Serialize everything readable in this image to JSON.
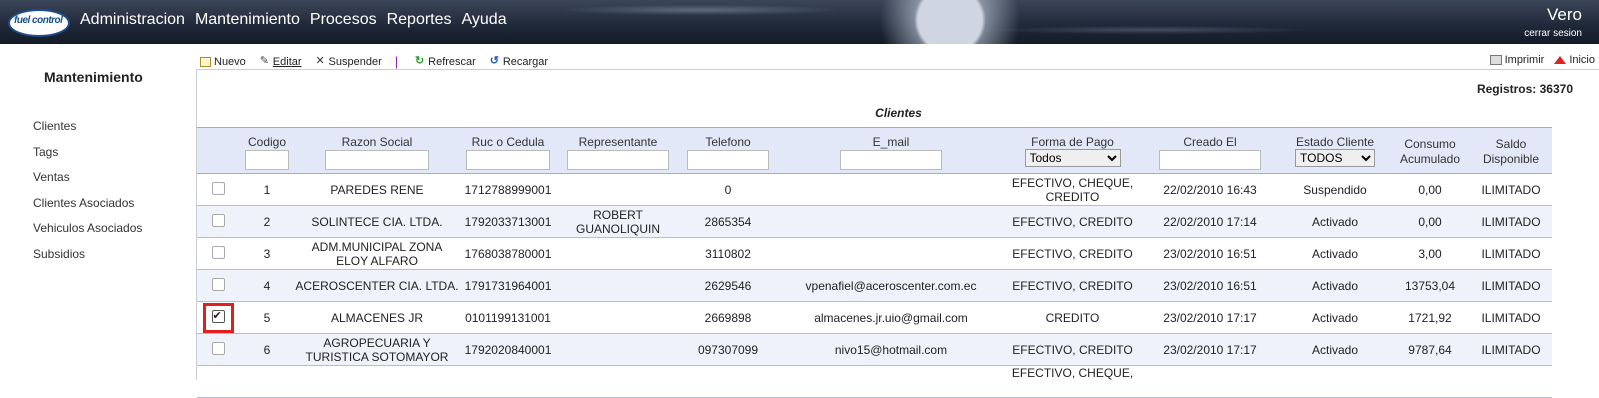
{
  "app": {
    "logo_text": "fuel control",
    "user": "Vero",
    "logout": "cerrar sesion"
  },
  "menu": [
    "Administracion",
    "Mantenimiento",
    "Procesos",
    "Reportes",
    "Ayuda"
  ],
  "sidebar": {
    "title": "Mantenimiento",
    "items": [
      "Clientes",
      "Tags",
      "Ventas",
      "Clientes Asociados",
      "Vehiculos Asociados",
      "Subsidios"
    ]
  },
  "toolbar": {
    "nuevo": "Nuevo",
    "editar": "Editar",
    "suspender": "Suspender",
    "separator": "|",
    "refrescar": "Refrescar",
    "recargar": "Recargar"
  },
  "top_right": {
    "imprimir": "Imprimir",
    "inicio": "Inicio"
  },
  "registros": "Registros: 36370",
  "table_title": "Clientes",
  "columns": [
    "Codigo",
    "Razon Social",
    "Ruc o Cedula",
    "Representante",
    "Telefono",
    "E_mail",
    "Forma de Pago",
    "Creado El",
    "Estado Cliente",
    "Consumo Acumulado",
    "Saldo Disponible"
  ],
  "filters": {
    "forma_pago": "Todos",
    "estado": "TODOS"
  },
  "rows": [
    {
      "checked": false,
      "codigo": "1",
      "razon": "PAREDES RENE",
      "ruc": "1712788999001",
      "rep": "",
      "tel": "0",
      "email": "",
      "pago": "EFECTIVO, CHEQUE, CREDITO",
      "creado": "22/02/2010 16:43",
      "estado": "Suspendido",
      "consumo": "0,00",
      "saldo": "ILIMITADO"
    },
    {
      "checked": false,
      "codigo": "2",
      "razon": "SOLINTECE CIA. LTDA.",
      "ruc": "1792033713001",
      "rep": "ROBERT GUANOLIQUIN",
      "tel": "2865354",
      "email": "",
      "pago": "EFECTIVO, CREDITO",
      "creado": "22/02/2010 17:14",
      "estado": "Activado",
      "consumo": "0,00",
      "saldo": "ILIMITADO"
    },
    {
      "checked": false,
      "codigo": "3",
      "razon": "ADM.MUNICIPAL ZONA ELOY ALFARO",
      "ruc": "1768038780001",
      "rep": "",
      "tel": "3110802",
      "email": "",
      "pago": "EFECTIVO, CREDITO",
      "creado": "23/02/2010 16:51",
      "estado": "Activado",
      "consumo": "3,00",
      "saldo": "ILIMITADO"
    },
    {
      "checked": false,
      "codigo": "4",
      "razon": "ACEROSCENTER CIA. LTDA.",
      "ruc": "1791731964001",
      "rep": "",
      "tel": "2629546",
      "email": "vpenafiel@aceroscenter.com.ec",
      "pago": "EFECTIVO, CREDITO",
      "creado": "23/02/2010 16:51",
      "estado": "Activado",
      "consumo": "13753,04",
      "saldo": "ILIMITADO"
    },
    {
      "checked": true,
      "codigo": "5",
      "razon": "ALMACENES JR",
      "ruc": "0101199131001",
      "rep": "",
      "tel": "2669898",
      "email": "almacenes.jr.uio@gmail.com",
      "pago": "CREDITO",
      "creado": "23/02/2010 17:17",
      "estado": "Activado",
      "consumo": "1721,92",
      "saldo": "ILIMITADO"
    },
    {
      "checked": false,
      "codigo": "6",
      "razon": "AGROPECUARIA Y TURISTICA SOTOMAYOR",
      "ruc": "1792020840001",
      "rep": "",
      "tel": "097307099",
      "email": "nivo15@hotmail.com",
      "pago": "EFECTIVO, CREDITO",
      "creado": "23/02/2010 17:17",
      "estado": "Activado",
      "consumo": "9787,64",
      "saldo": "ILIMITADO"
    },
    {
      "checked": false,
      "codigo": "",
      "razon": "",
      "ruc": "",
      "rep": "",
      "tel": "",
      "email": "",
      "pago": "EFECTIVO, CHEQUE,",
      "creado": "",
      "estado": "",
      "consumo": "",
      "saldo": ""
    }
  ]
}
